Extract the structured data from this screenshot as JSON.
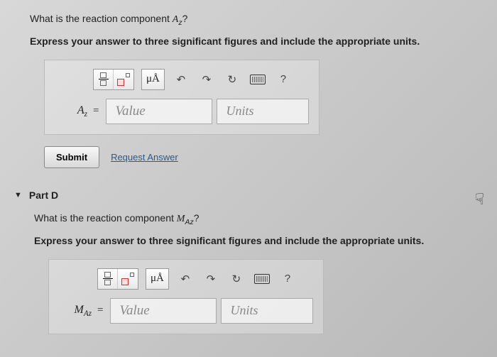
{
  "partC": {
    "question_prefix": "What is the reaction component ",
    "variable": "A",
    "subscript": "z",
    "question_suffix": "?",
    "instruction": "Express your answer to three significant figures and include the appropriate units.",
    "toolbar": {
      "mu_label": "μÅ",
      "help_label": "?"
    },
    "label_var": "A",
    "label_sub": "z",
    "value_placeholder": "Value",
    "units_placeholder": "Units",
    "submit_label": "Submit",
    "request_label": "Request Answer"
  },
  "partD": {
    "title": "Part D",
    "question_prefix": "What is the reaction component ",
    "variable": "M",
    "subscript": "Az",
    "question_suffix": "?",
    "instruction": "Express your answer to three significant figures and include the appropriate units.",
    "toolbar": {
      "mu_label": "μÅ",
      "help_label": "?"
    },
    "label_var": "M",
    "label_sub": "Az",
    "value_placeholder": "Value",
    "units_placeholder": "Units"
  }
}
